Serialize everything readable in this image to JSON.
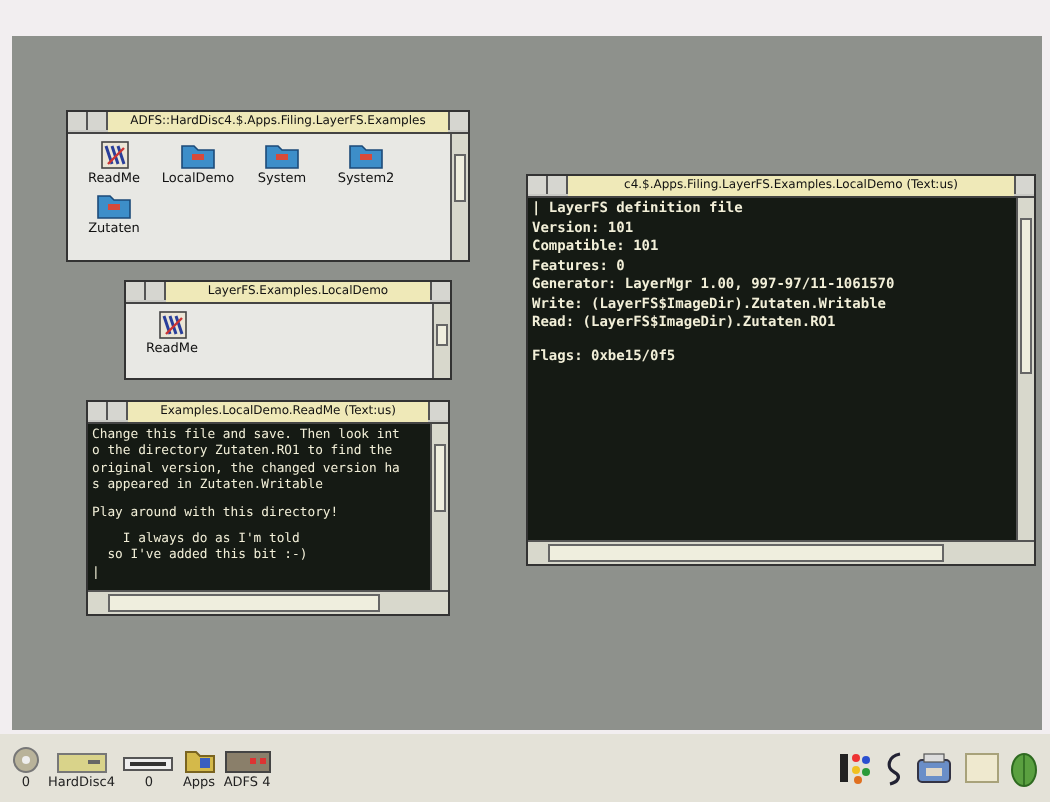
{
  "windows": [
    {
      "kind": "filer",
      "title": "ADFS::HardDisc4.$.Apps.Filing.LayerFS.Examples",
      "items": [
        {
          "kind": "text-file",
          "label": "ReadMe"
        },
        {
          "kind": "folder",
          "label": "LocalDemo"
        },
        {
          "kind": "folder",
          "label": "System"
        },
        {
          "kind": "folder",
          "label": "System2"
        },
        {
          "kind": "folder",
          "label": "Zutaten"
        }
      ]
    },
    {
      "kind": "filer",
      "title": "LayerFS.Examples.LocalDemo",
      "items": [
        {
          "kind": "text-file",
          "label": "ReadMe"
        }
      ]
    },
    {
      "kind": "text",
      "title": "Examples.LocalDemo.ReadMe (Text:us)",
      "paragraphs": [
        [
          "Change this file and save. Then look int",
          "o the directory Zutaten.RO1 to find the",
          "original version, the changed version ha",
          "s appeared in Zutaten.Writable"
        ],
        [
          "Play around with this directory!"
        ],
        [
          "    I always do as I'm told",
          "  so I've added this bit :-)",
          "|"
        ]
      ]
    },
    {
      "kind": "text",
      "title": "c4.$.Apps.Filing.LayerFS.Examples.LocalDemo (Text:us)",
      "paragraphs": [
        [
          "| LayerFS definition file",
          "Version: 101",
          "Compatible: 101",
          "Features: 0",
          "Generator: LayerMgr 1.00, 997-97/11-1061570",
          "Write: (LayerFS$ImageDir).Zutaten.Writable",
          "Read: (LayerFS$ImageDir).Zutaten.RO1"
        ],
        [
          "Flags: 0xbe15/0f5"
        ]
      ]
    }
  ],
  "iconbar": {
    "left": [
      {
        "kind": "floppy",
        "label": "0"
      },
      {
        "kind": "harddisc",
        "label": "HardDisc4"
      },
      {
        "kind": "ramdisc",
        "label": "0"
      },
      {
        "kind": "apps",
        "label": "Apps"
      },
      {
        "kind": "adfs",
        "label": "ADFS 4"
      }
    ],
    "right": [
      {
        "kind": "palette"
      },
      {
        "kind": "squiggle"
      },
      {
        "kind": "printer"
      },
      {
        "kind": "display"
      },
      {
        "kind": "acorn"
      }
    ]
  }
}
